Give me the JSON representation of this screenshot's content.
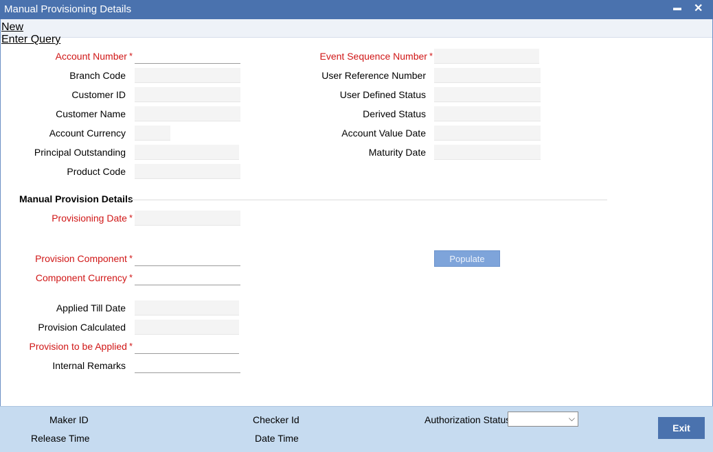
{
  "window": {
    "title": "Manual Provisioning Details",
    "minimize": "▬",
    "close": "✕"
  },
  "toolbar": {
    "new_label": "New",
    "enter_query_label": "Enter Query"
  },
  "left_fields": [
    {
      "label": "Account Number",
      "required": true
    },
    {
      "label": "Branch Code",
      "required": false
    },
    {
      "label": "Customer ID",
      "required": false
    },
    {
      "label": "Customer Name",
      "required": false
    },
    {
      "label": "Account Currency",
      "required": false
    },
    {
      "label": "Principal Outstanding",
      "required": false
    },
    {
      "label": "Product Code",
      "required": false
    }
  ],
  "right_fields": [
    {
      "label": "Event Sequence Number",
      "required": true
    },
    {
      "label": "User Reference Number",
      "required": false
    },
    {
      "label": "User Defined Status",
      "required": false
    },
    {
      "label": "Derived Status",
      "required": false
    },
    {
      "label": "Account Value Date",
      "required": false
    },
    {
      "label": "Maturity Date",
      "required": false
    }
  ],
  "section": {
    "title": "Manual Provision Details"
  },
  "provision": {
    "provisioning_date": "Provisioning Date",
    "provision_component": "Provision Component",
    "component_currency": "Component Currency",
    "applied_till_date": "Applied Till Date",
    "provision_calculated": "Provision Calculated",
    "provision_to_be_applied": "Provision to be Applied",
    "internal_remarks": "Internal Remarks",
    "populate_button": "Populate"
  },
  "required_marker": "*",
  "footer": {
    "maker_id": "Maker ID",
    "release_time": "Release Time",
    "checker_id": "Checker Id",
    "date_time": "Date Time",
    "authorization_status": "Authorization Status",
    "authorization_value": "",
    "exit_button": "Exit",
    "select_chevron": "⌵"
  },
  "colors": {
    "title_bar": "#4a72ae",
    "required_label": "#d01616",
    "footer_bg": "#c6dbf0"
  }
}
